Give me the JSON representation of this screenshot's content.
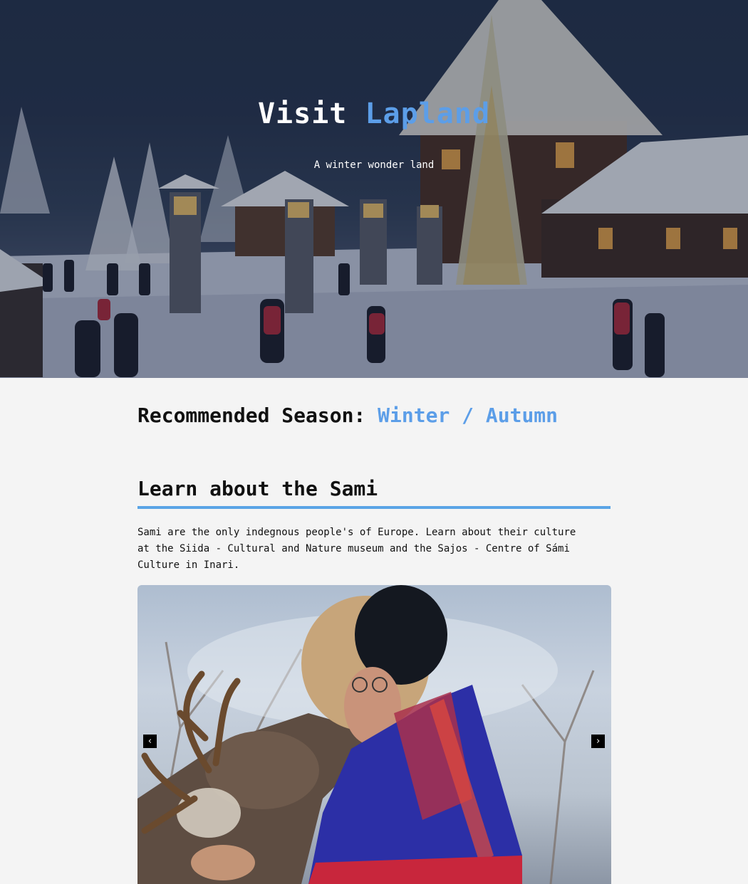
{
  "hero": {
    "title_part1": "Visit",
    "title_part2": "Lapland",
    "subtitle": "A winter wonder land",
    "accent_color": "#5c9ee8"
  },
  "season": {
    "label": "Recommended Season:",
    "value": "Winter / Autumn"
  },
  "sami_section": {
    "title": "Learn about the Sami",
    "text": "Sami are the only indegnous people's of Europe. Learn about their culture at the Siida - Cultural and Nature museum and the Sajos - Centre of Sámi Culture in Inari.",
    "underline_color": "#5aa4e6"
  },
  "carousel": {
    "prev_icon": "chevron-left-icon",
    "next_icon": "chevron-right-icon",
    "prev_glyph": "‹",
    "next_glyph": "›"
  }
}
